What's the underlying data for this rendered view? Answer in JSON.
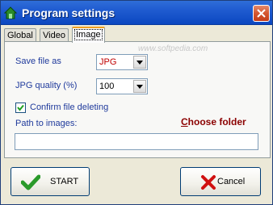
{
  "window": {
    "title": "Program settings"
  },
  "tabs": [
    {
      "label": "Global"
    },
    {
      "label": "Video"
    },
    {
      "label": "Image"
    }
  ],
  "image_tab": {
    "save_file_as_label": "Save file as",
    "save_file_as_value": "JPG",
    "jpg_quality_label": "JPG quality (%)",
    "jpg_quality_value": "100",
    "confirm_delete_label": "Confirm file deleting",
    "confirm_delete_checked": true,
    "path_label": "Path to images:",
    "path_value": "",
    "choose_folder_first": "C",
    "choose_folder_rest": "hoose folder"
  },
  "watermark": "www.softpedia.com",
  "footer": {
    "start_label": "START",
    "cancel_label": "Cancel"
  },
  "icons": {
    "app": "app-icon",
    "close": "close-icon",
    "dropdown": "chevron-down-icon",
    "check": "checkmark-icon",
    "start": "green-check-icon",
    "cancel": "red-x-icon"
  },
  "colors": {
    "titlebar": "#0b47c0",
    "label_blue": "#1f3a9c",
    "accent_red": "#8b0000",
    "start_green": "#2a9a2a",
    "cancel_red": "#d01010"
  }
}
